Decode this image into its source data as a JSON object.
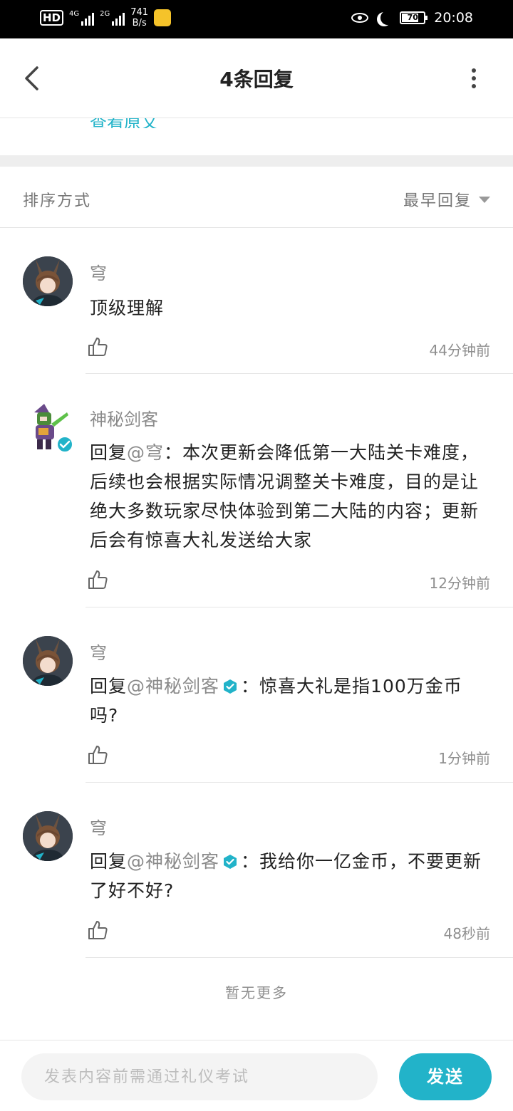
{
  "status_bar": {
    "hd": "HD",
    "net1": "4G",
    "net2": "2G",
    "speed_value": "741",
    "speed_unit": "B/s",
    "battery": "70",
    "battery_level": 0.7,
    "time": "20:08"
  },
  "header": {
    "title": "4条回复",
    "peek_text": "查看原文"
  },
  "sort": {
    "label": "排序方式",
    "selected": "最早回复"
  },
  "replies": [
    {
      "name": "穹",
      "prefix": "",
      "mention": "",
      "verified_mention": false,
      "text": "顶级理解",
      "time": "44分钟前"
    },
    {
      "name": "神秘剑客",
      "prefix": "回复",
      "mention": "@穹",
      "verified_mention": false,
      "text": "：本次更新会降低第一大陆关卡难度，后续也会根据实际情况调整关卡难度，目的是让绝大多数玩家尽快体验到第二大陆的内容；更新后会有惊喜大礼发送给大家",
      "time": "12分钟前"
    },
    {
      "name": "穹",
      "prefix": "回复",
      "mention": "@神秘剑客",
      "verified_mention": true,
      "text": "：惊喜大礼是指100万金币吗?",
      "time": "1分钟前"
    },
    {
      "name": "穹",
      "prefix": "回复",
      "mention": "@神秘剑客",
      "verified_mention": true,
      "text": "：我给你一亿金币，不要更新了好不好?",
      "time": "48秒前"
    }
  ],
  "footer_note": "暂无更多",
  "input": {
    "placeholder": "发表内容前需通过礼仪考试",
    "send_label": "发送"
  },
  "colors": {
    "accent": "#22b3c9",
    "muted_text": "#8a8a8a",
    "divider": "#e6e6e6"
  }
}
